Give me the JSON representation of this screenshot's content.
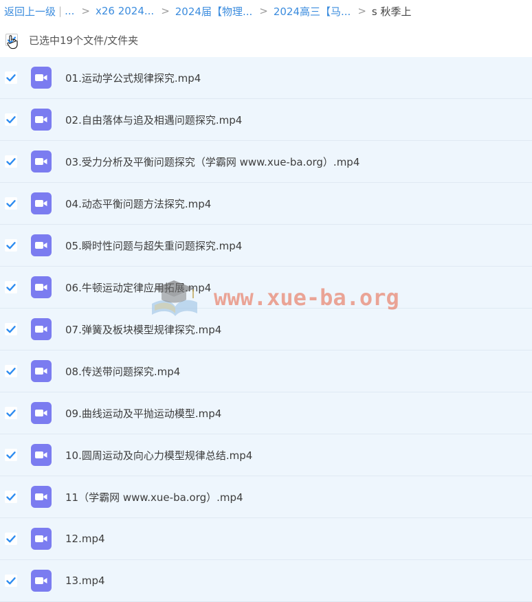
{
  "breadcrumb": {
    "back_label": "返回上一级",
    "divider": "|",
    "ellipsis": "...",
    "sep": ">",
    "crumbs": [
      "x26 2024...",
      "2024届【物理...",
      "2024高三【马..."
    ],
    "current": "s 秋季上"
  },
  "selection": {
    "text": "已选中19个文件/文件夹"
  },
  "files": [
    {
      "name": "01.运动学公式规律探究.mp4"
    },
    {
      "name": "02.自由落体与追及相遇问题探究.mp4"
    },
    {
      "name": "03.受力分析及平衡问题探究（学霸网 www.xue-ba.org）.mp4"
    },
    {
      "name": "04.动态平衡问题方法探究.mp4"
    },
    {
      "name": "05.瞬时性问题与超失重问题探究.mp4"
    },
    {
      "name": "06.牛顿运动定律应用拓展.mp4"
    },
    {
      "name": "07.弹簧及板块模型规律探究.mp4"
    },
    {
      "name": "08.传送带问题探究.mp4"
    },
    {
      "name": "09.曲线运动及平抛运动模型.mp4"
    },
    {
      "name": "10.圆周运动及向心力模型规律总结.mp4"
    },
    {
      "name": "11（学霸网 www.xue-ba.org）.mp4"
    },
    {
      "name": "12.mp4"
    },
    {
      "name": "13.mp4"
    }
  ],
  "watermark": {
    "text": "www.xue-ba.org"
  },
  "colors": {
    "link": "#3b8cde",
    "row_bg": "#eef6fd",
    "check": "#2d8cf0",
    "video_icon": "#7b7cf0"
  },
  "icons": {
    "checkbox": "checkbox-checked-icon",
    "file": "video-file-icon",
    "cursor": "hand-pointer-icon",
    "watermark_logo": "graduation-cap-book-icon"
  }
}
